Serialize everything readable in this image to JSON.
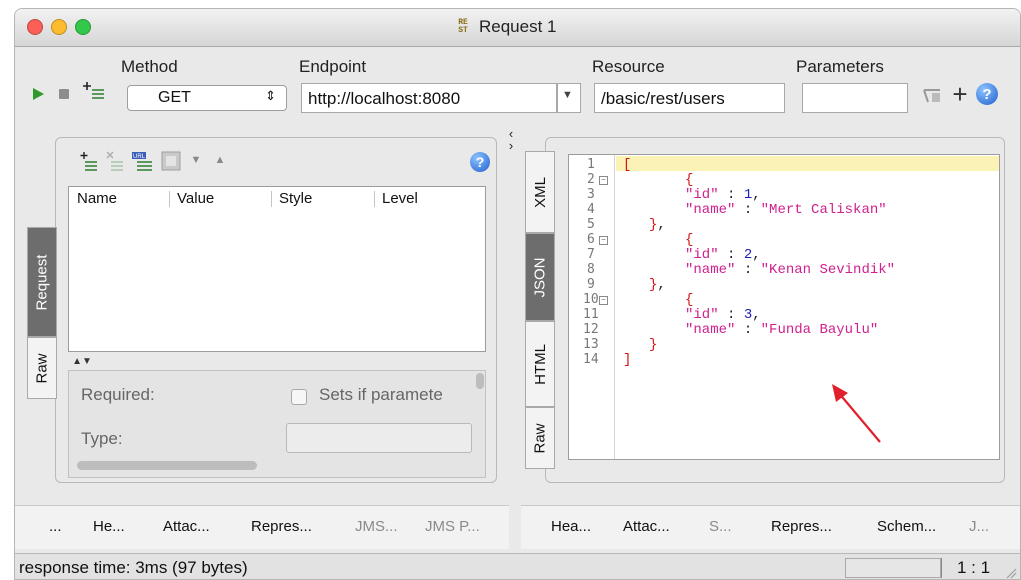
{
  "window": {
    "title": "Request 1",
    "title_icon": "rest-icon",
    "colors": {
      "close": "#fc5f57",
      "minimize": "#fdbc2d",
      "zoom": "#34c84a"
    }
  },
  "toolbar": {
    "method_label": "Method",
    "method_value": "GET",
    "endpoint_label": "Endpoint",
    "endpoint_value": "http://localhost:8080",
    "resource_label": "Resource",
    "resource_value": "/basic/rest/users",
    "parameters_label": "Parameters",
    "parameters_value": "",
    "icons": [
      "run-icon",
      "stop-icon",
      "add-step-icon",
      "tune-icon",
      "add-icon",
      "help-icon"
    ]
  },
  "request_panel": {
    "side_tabs": [
      "Request",
      "Raw"
    ],
    "selected_tab": "Request",
    "table_headers": [
      "Name",
      "Value",
      "Style",
      "Level"
    ],
    "rows": [],
    "details": {
      "required_label": "Required:",
      "sets_if_label": "Sets if paramete",
      "type_label": "Type:"
    },
    "bottom_tabs": [
      "...",
      "He...",
      "Attac...",
      "Repres...",
      "JMS...",
      "JMS P..."
    ]
  },
  "response_panel": {
    "side_tabs": [
      "XML",
      "JSON",
      "HTML",
      "Raw"
    ],
    "selected_tab": "JSON",
    "line_numbers": [
      "1",
      "2",
      "3",
      "4",
      "5",
      "6",
      "7",
      "8",
      "9",
      "10",
      "11",
      "12",
      "13",
      "14"
    ],
    "users": [
      {
        "id": "1",
        "name": "\"Mert Caliskan\""
      },
      {
        "id": "2",
        "name": "\"Kenan Sevindik\""
      },
      {
        "id": "3",
        "name": "\"Funda Bayulu\""
      }
    ],
    "bottom_tabs": [
      "Hea...",
      "Attac...",
      "S...",
      "Repres...",
      "Schem...",
      "J..."
    ]
  },
  "status": {
    "text": "response time: 3ms (97 bytes)",
    "position": "1 : 1"
  },
  "annotation_color": "#e0202a"
}
